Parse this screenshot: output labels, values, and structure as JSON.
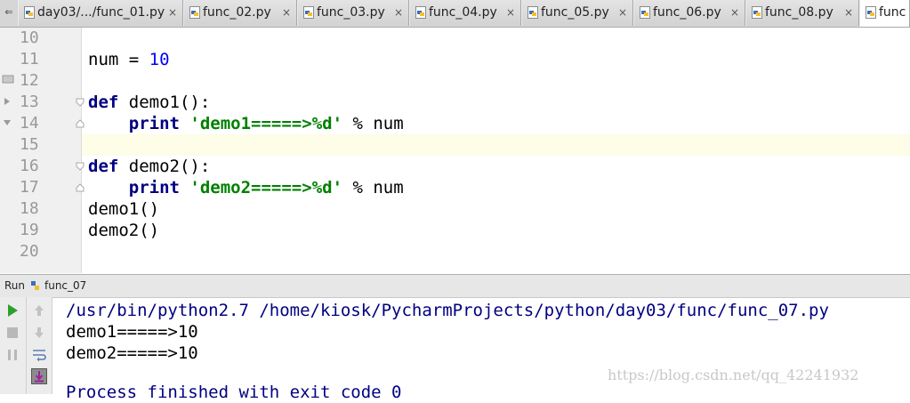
{
  "tabs": [
    {
      "label": "day03/.../func_01.py",
      "close": "×"
    },
    {
      "label": "func_02.py",
      "close": "×"
    },
    {
      "label": "func_03.py",
      "close": "×"
    },
    {
      "label": "func_04.py",
      "close": "×"
    },
    {
      "label": "func_05.py",
      "close": "×"
    },
    {
      "label": "func_06.py",
      "close": "×"
    },
    {
      "label": "func_08.py",
      "close": "×"
    },
    {
      "label": "func",
      "close": ""
    }
  ],
  "tab_scroll_glyph": "⇐",
  "editor": {
    "line_numbers": [
      "10",
      "11",
      "12",
      "13",
      "14",
      "15",
      "16",
      "17",
      "18",
      "19",
      "20"
    ],
    "lines": {
      "l11": {
        "name": "num",
        "op": " = ",
        "value": "10"
      },
      "l13": {
        "kw": "def",
        "rest": " demo1():"
      },
      "l14": {
        "kw": "print",
        "str": "'demo1=====>%d'",
        "rest": " % num"
      },
      "l16": {
        "kw": "def",
        "rest": " demo2():"
      },
      "l17": {
        "kw": "print",
        "str": "'demo2=====>%d'",
        "rest": " % num"
      },
      "l18": "demo1()",
      "l19": "demo2()"
    }
  },
  "run_panel": {
    "label": "Run",
    "config_name": "func_07",
    "output": [
      "/usr/bin/python2.7 /home/kiosk/PycharmProjects/python/day03/func/func_07.py",
      "demo1=====>10",
      "demo2=====>10",
      "Process finished with exit code 0"
    ]
  },
  "watermark": "https://blog.csdn.net/qq_42241932",
  "colors": {
    "keyword": "#000080",
    "string": "#008000",
    "number": "#0000ff",
    "current_line": "#fdfde8",
    "run_green": "#2ca02c"
  }
}
